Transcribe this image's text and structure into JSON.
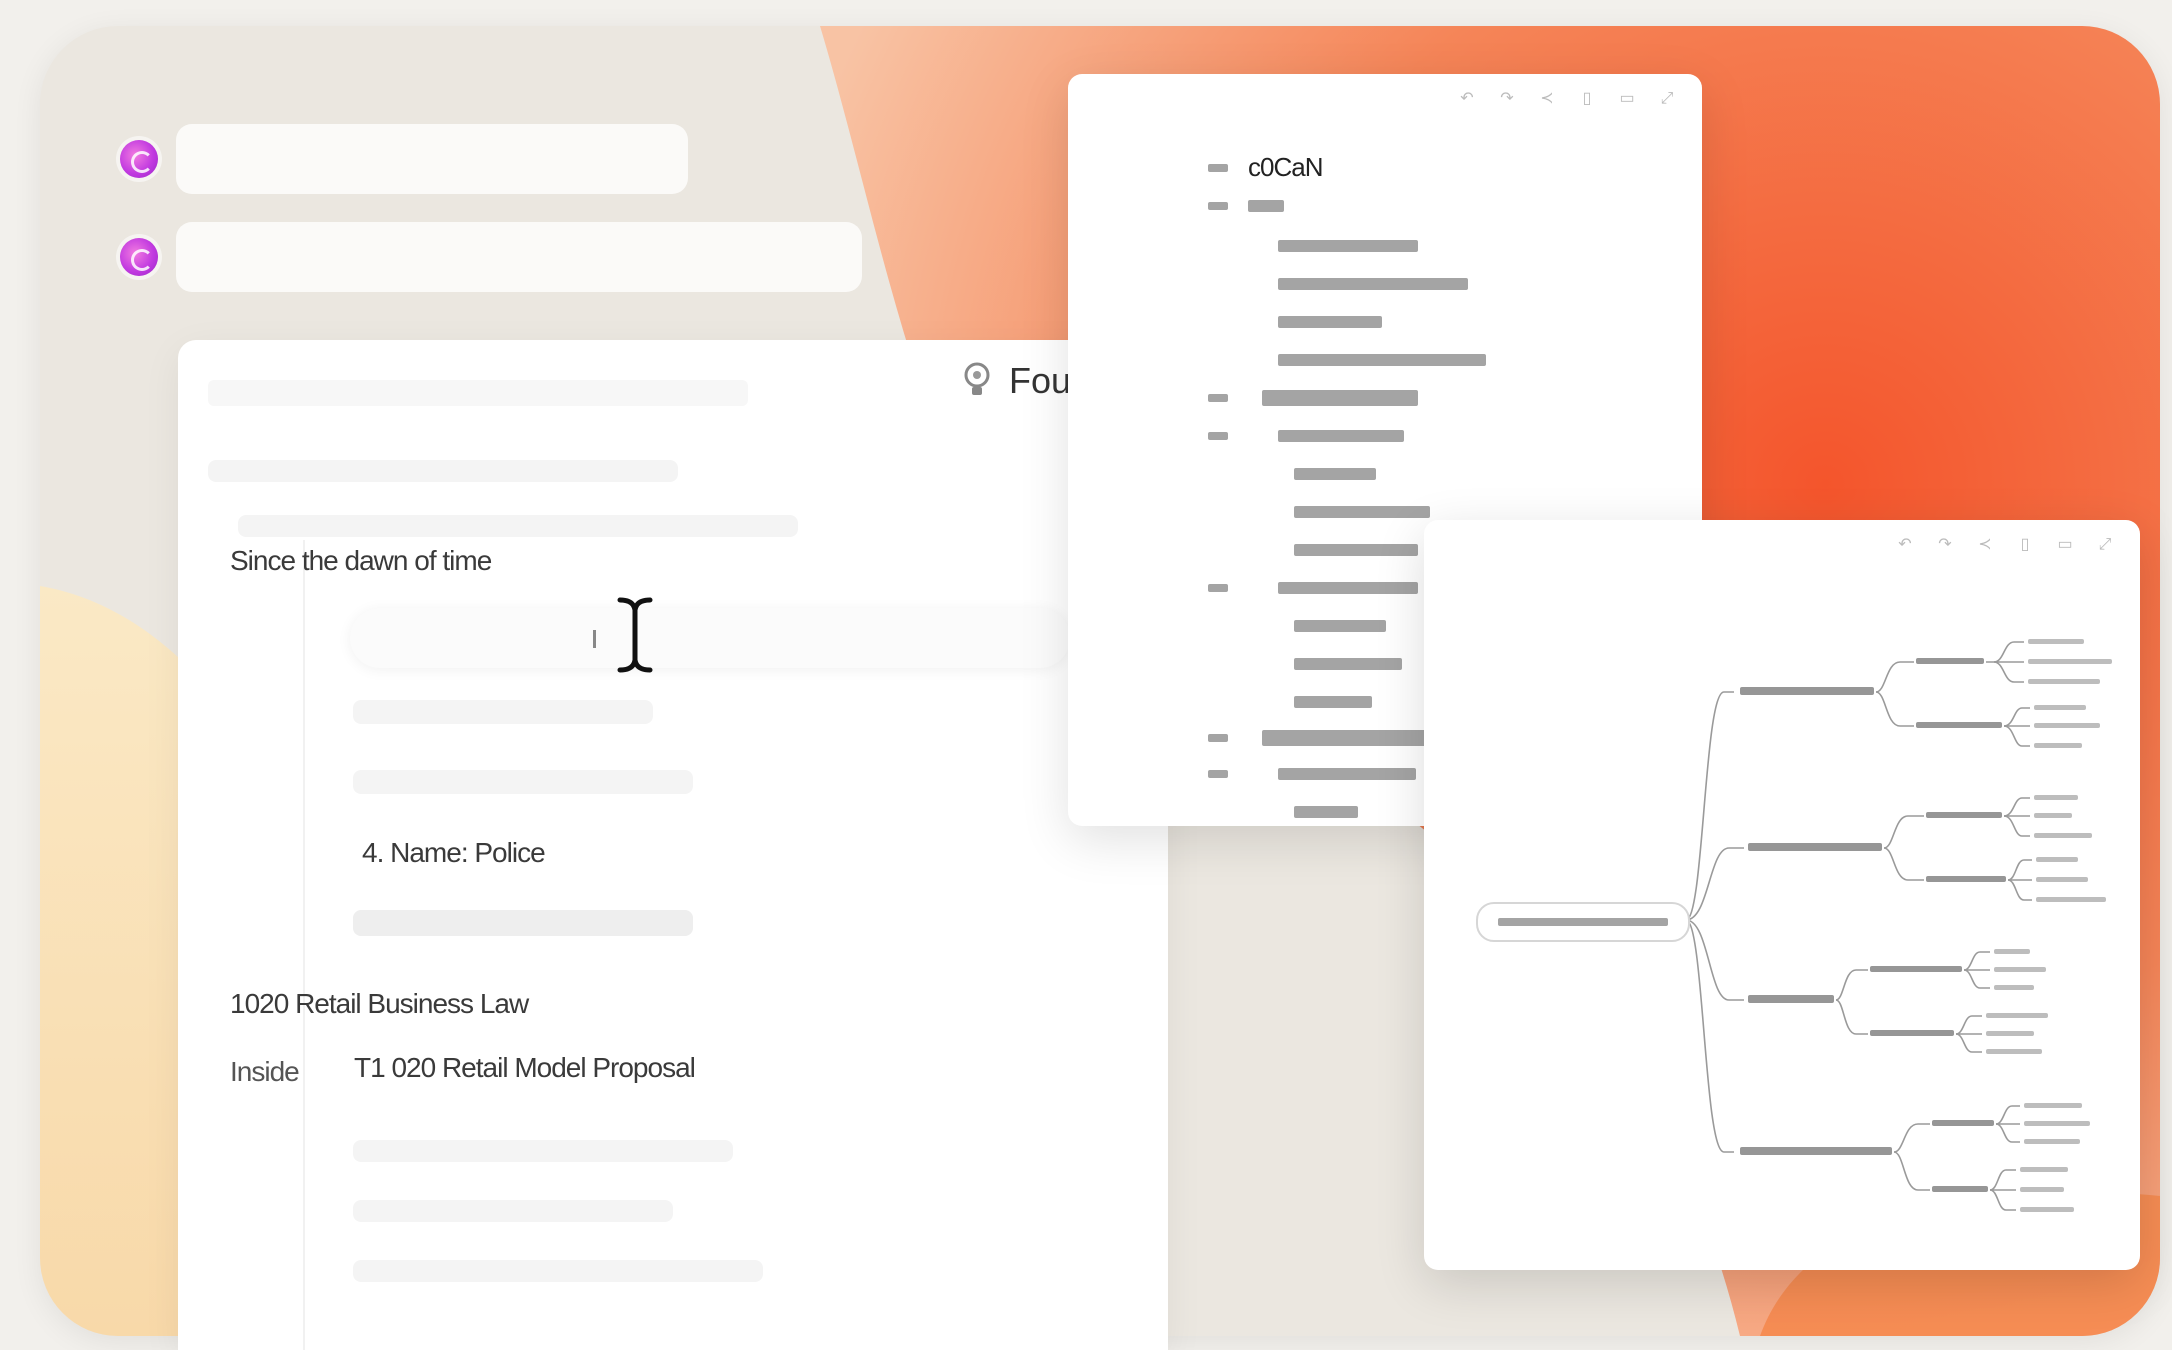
{
  "colors": {
    "accent_orange": "#f26a3c",
    "accent_peach": "#f6a77c",
    "cream": "#fbe9bf",
    "avatar": "#c23be0"
  },
  "icons": {
    "hint": "lightbulb-icon",
    "cursor": "text-cursor-icon",
    "avatar": "assistant-avatar-icon"
  },
  "document": {
    "heading": "Four",
    "intro": "Since the dawn of time",
    "item_4": "4. Name: Police",
    "law_title": "1020 Retail Business Law",
    "inside_label": "Inside",
    "proposal": "T1 020 Retail Model Proposal"
  },
  "outline": {
    "title": "c0CaN"
  }
}
